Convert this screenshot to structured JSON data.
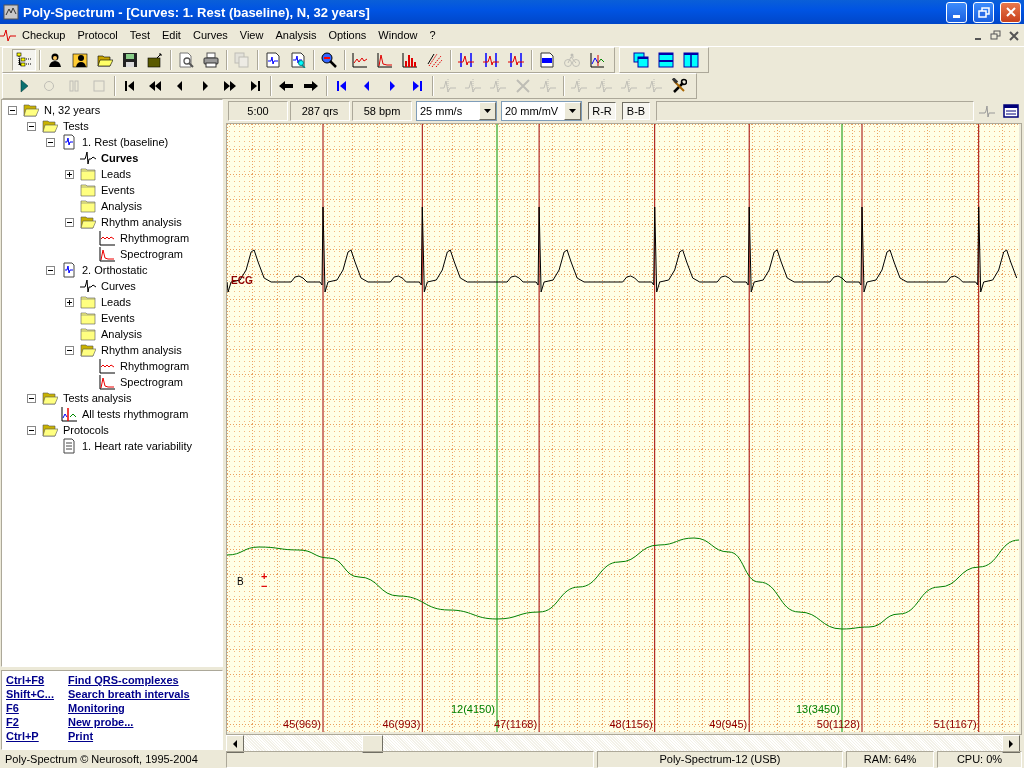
{
  "window": {
    "title": "Poly-Spectrum - [Curves: 1. Rest (baseline), N, 32 years]"
  },
  "menu": [
    {
      "label": "Checkup"
    },
    {
      "label": "Protocol"
    },
    {
      "label": "Test"
    },
    {
      "label": "Edit"
    },
    {
      "label": "Curves"
    },
    {
      "label": "View"
    },
    {
      "label": "Analysis"
    },
    {
      "label": "Options"
    },
    {
      "label": "Window"
    },
    {
      "label": "?"
    }
  ],
  "toolbar_1": [
    [
      {
        "kind": "tree-view",
        "selected": true,
        "disabled": false
      }
    ],
    [
      {
        "kind": "person",
        "selected": false,
        "disabled": false
      },
      {
        "kind": "person-card",
        "selected": false,
        "disabled": false
      },
      {
        "kind": "folder-open",
        "selected": false,
        "disabled": false
      },
      {
        "kind": "save",
        "selected": false,
        "disabled": false
      },
      {
        "kind": "folder-up",
        "selected": false,
        "disabled": false
      }
    ],
    [
      {
        "kind": "preview",
        "selected": false,
        "disabled": false
      },
      {
        "kind": "print",
        "selected": false,
        "disabled": false
      }
    ],
    [
      {
        "kind": "export",
        "selected": false,
        "disabled": true
      }
    ],
    [
      {
        "kind": "doc-ecg",
        "selected": false,
        "disabled": false
      },
      {
        "kind": "doc-search",
        "selected": false,
        "disabled": false
      }
    ],
    [
      {
        "kind": "magnifier",
        "selected": false,
        "disabled": false
      }
    ],
    [
      {
        "kind": "chart-line",
        "selected": false,
        "disabled": false
      },
      {
        "kind": "chart-spectrum",
        "selected": false,
        "disabled": false
      },
      {
        "kind": "chart-bars",
        "selected": false,
        "disabled": false
      },
      {
        "kind": "chart-scatter",
        "selected": false,
        "disabled": false
      }
    ],
    [
      {
        "kind": "marker",
        "selected": false,
        "disabled": false
      },
      {
        "kind": "marker",
        "selected": false,
        "disabled": false
      },
      {
        "kind": "marker",
        "selected": false,
        "disabled": false
      }
    ],
    [
      {
        "kind": "page",
        "selected": false,
        "disabled": false
      },
      {
        "kind": "bike",
        "selected": false,
        "disabled": true
      },
      {
        "kind": "chart-axes",
        "selected": false,
        "disabled": false
      }
    ]
  ],
  "toolbar_windows": [
    {
      "kind": "cascade",
      "selected": false,
      "disabled": false
    },
    {
      "kind": "tile-h",
      "selected": false,
      "disabled": false
    },
    {
      "kind": "tile-v",
      "selected": false,
      "disabled": false
    }
  ],
  "toolbar_2": [
    [
      {
        "kind": "play",
        "selected": false,
        "disabled": false
      },
      {
        "kind": "record",
        "selected": false,
        "disabled": true
      },
      {
        "kind": "pause",
        "selected": false,
        "disabled": true
      },
      {
        "kind": "stop",
        "selected": false,
        "disabled": true
      }
    ],
    [
      {
        "kind": "first",
        "selected": false,
        "disabled": false
      },
      {
        "kind": "rewind",
        "selected": false,
        "disabled": false
      },
      {
        "kind": "back",
        "selected": false,
        "disabled": false
      },
      {
        "kind": "forward",
        "selected": false,
        "disabled": false
      },
      {
        "kind": "ffwd",
        "selected": false,
        "disabled": false
      },
      {
        "kind": "last",
        "selected": false,
        "disabled": false
      }
    ],
    [
      {
        "kind": "arrow-left",
        "selected": false,
        "disabled": false
      },
      {
        "kind": "arrow-right",
        "selected": false,
        "disabled": false
      }
    ],
    [
      {
        "kind": "blue-first",
        "selected": false,
        "disabled": false
      },
      {
        "kind": "blue-back",
        "selected": false,
        "disabled": false
      },
      {
        "kind": "blue-forward",
        "selected": false,
        "disabled": false
      },
      {
        "kind": "blue-last",
        "selected": false,
        "disabled": false
      }
    ],
    [
      {
        "kind": "wave-tool",
        "selected": false,
        "disabled": true
      },
      {
        "kind": "wave-tool",
        "selected": false,
        "disabled": true
      },
      {
        "kind": "wave-tool",
        "selected": false,
        "disabled": true
      },
      {
        "kind": "cross",
        "selected": false,
        "disabled": true
      },
      {
        "kind": "wave-tool",
        "selected": false,
        "disabled": true
      }
    ],
    [
      {
        "kind": "wave-tool",
        "selected": false,
        "disabled": true
      },
      {
        "kind": "wave-tool",
        "selected": false,
        "disabled": true
      },
      {
        "kind": "wave-tool",
        "selected": false,
        "disabled": true
      },
      {
        "kind": "wave-tool",
        "selected": false,
        "disabled": true
      },
      {
        "kind": "tools",
        "selected": false,
        "disabled": false
      }
    ]
  ],
  "tree": [
    {
      "label": "N, 32 years",
      "kind": "folder-open",
      "expanded": true,
      "selected": false,
      "children": [
        {
          "label": "Tests",
          "kind": "folder-open",
          "expanded": true,
          "selected": false,
          "children": [
            {
              "label": "1. Rest (baseline)",
              "kind": "test",
              "expanded": true,
              "selected": false,
              "children": [
                {
                  "label": "Curves",
                  "kind": "ecg",
                  "selected": true
                },
                {
                  "label": "Leads",
                  "kind": "folder",
                  "expanded": false,
                  "selected": false
                },
                {
                  "label": "Events",
                  "kind": "folder",
                  "selected": false
                },
                {
                  "label": "Analysis",
                  "kind": "folder",
                  "selected": false
                },
                {
                  "label": "Rhythm analysis",
                  "kind": "folder-open",
                  "expanded": true,
                  "selected": false,
                  "children": [
                    {
                      "label": "Rhythmogram",
                      "kind": "rhythmogram",
                      "selected": false
                    },
                    {
                      "label": "Spectrogram",
                      "kind": "spectrogram",
                      "selected": false
                    }
                  ]
                }
              ]
            },
            {
              "label": "2. Orthostatic",
              "kind": "test",
              "expanded": true,
              "selected": false,
              "children": [
                {
                  "label": "Curves",
                  "kind": "ecg",
                  "selected": false
                },
                {
                  "label": "Leads",
                  "kind": "folder",
                  "expanded": false,
                  "selected": false
                },
                {
                  "label": "Events",
                  "kind": "folder",
                  "selected": false
                },
                {
                  "label": "Analysis",
                  "kind": "folder",
                  "selected": false
                },
                {
                  "label": "Rhythm analysis",
                  "kind": "folder-open",
                  "expanded": true,
                  "selected": false,
                  "children": [
                    {
                      "label": "Rhythmogram",
                      "kind": "rhythmogram",
                      "selected": false
                    },
                    {
                      "label": "Spectrogram",
                      "kind": "spectrogram",
                      "selected": false
                    }
                  ]
                }
              ]
            }
          ]
        },
        {
          "label": "Tests analysis",
          "kind": "folder-open",
          "expanded": true,
          "selected": false,
          "children": [
            {
              "label": "All tests rhythmogram",
              "kind": "multi",
              "selected": false
            }
          ]
        },
        {
          "label": "Protocols",
          "kind": "folder-open",
          "expanded": true,
          "selected": false,
          "children": [
            {
              "label": "1. Heart rate variability",
              "kind": "protocol",
              "selected": false
            }
          ]
        }
      ]
    }
  ],
  "shortcuts": [
    {
      "key": "Ctrl+F8",
      "label": "Find QRS-complexes"
    },
    {
      "key": "Shift+C...",
      "label": "Search breath intervals"
    },
    {
      "key": "F6",
      "label": "Monitoring"
    },
    {
      "key": "F2",
      "label": "New probe..."
    },
    {
      "key": "Ctrl+P",
      "label": "Print"
    }
  ],
  "curves_header": {
    "duration": "5:00",
    "qrs_count": "287 qrs",
    "heart_rate": "58 bpm",
    "speed": "25 mm/s",
    "gain": "20 mm/mV",
    "toggles": [
      {
        "label": "R-R",
        "selected": true
      },
      {
        "label": "B-B",
        "selected": true
      }
    ]
  },
  "plot": {
    "ecg_label": "ECG",
    "breath_label": "B",
    "scale_marks": [
      "+",
      "−"
    ],
    "beats": [
      {
        "label": "45(969)"
      },
      {
        "label": "46(993)"
      },
      {
        "label": "47(1168)"
      },
      {
        "label": "48(1156)"
      },
      {
        "label": "49(945)"
      },
      {
        "label": "50(1128)"
      },
      {
        "label": "51(1167)"
      }
    ],
    "breaths": [
      {
        "label": "12(4150)"
      },
      {
        "label": "13(3450)"
      }
    ]
  },
  "status_bar": {
    "copyright": "Poly-Spectrum © Neurosoft, 1995-2004",
    "device": "Poly-Spectrum-12 (USB)",
    "ram": "RAM: 64%",
    "cpu": "CPU: 0%"
  }
}
